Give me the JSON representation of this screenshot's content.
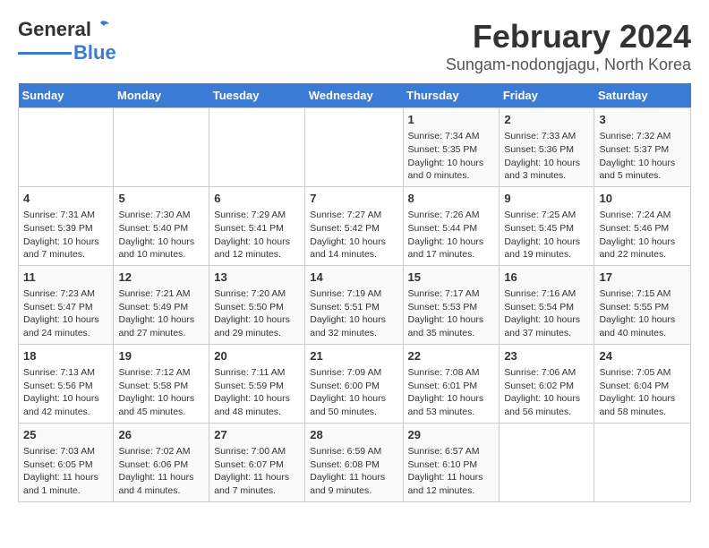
{
  "header": {
    "logo_general": "General",
    "logo_blue": "Blue",
    "title": "February 2024",
    "subtitle": "Sungam-nodongjagu, North Korea"
  },
  "calendar": {
    "weekdays": [
      "Sunday",
      "Monday",
      "Tuesday",
      "Wednesday",
      "Thursday",
      "Friday",
      "Saturday"
    ],
    "weeks": [
      [
        {
          "day": "",
          "info": ""
        },
        {
          "day": "",
          "info": ""
        },
        {
          "day": "",
          "info": ""
        },
        {
          "day": "",
          "info": ""
        },
        {
          "day": "1",
          "info": "Sunrise: 7:34 AM\nSunset: 5:35 PM\nDaylight: 10 hours and 0 minutes."
        },
        {
          "day": "2",
          "info": "Sunrise: 7:33 AM\nSunset: 5:36 PM\nDaylight: 10 hours and 3 minutes."
        },
        {
          "day": "3",
          "info": "Sunrise: 7:32 AM\nSunset: 5:37 PM\nDaylight: 10 hours and 5 minutes."
        }
      ],
      [
        {
          "day": "4",
          "info": "Sunrise: 7:31 AM\nSunset: 5:39 PM\nDaylight: 10 hours and 7 minutes."
        },
        {
          "day": "5",
          "info": "Sunrise: 7:30 AM\nSunset: 5:40 PM\nDaylight: 10 hours and 10 minutes."
        },
        {
          "day": "6",
          "info": "Sunrise: 7:29 AM\nSunset: 5:41 PM\nDaylight: 10 hours and 12 minutes."
        },
        {
          "day": "7",
          "info": "Sunrise: 7:27 AM\nSunset: 5:42 PM\nDaylight: 10 hours and 14 minutes."
        },
        {
          "day": "8",
          "info": "Sunrise: 7:26 AM\nSunset: 5:44 PM\nDaylight: 10 hours and 17 minutes."
        },
        {
          "day": "9",
          "info": "Sunrise: 7:25 AM\nSunset: 5:45 PM\nDaylight: 10 hours and 19 minutes."
        },
        {
          "day": "10",
          "info": "Sunrise: 7:24 AM\nSunset: 5:46 PM\nDaylight: 10 hours and 22 minutes."
        }
      ],
      [
        {
          "day": "11",
          "info": "Sunrise: 7:23 AM\nSunset: 5:47 PM\nDaylight: 10 hours and 24 minutes."
        },
        {
          "day": "12",
          "info": "Sunrise: 7:21 AM\nSunset: 5:49 PM\nDaylight: 10 hours and 27 minutes."
        },
        {
          "day": "13",
          "info": "Sunrise: 7:20 AM\nSunset: 5:50 PM\nDaylight: 10 hours and 29 minutes."
        },
        {
          "day": "14",
          "info": "Sunrise: 7:19 AM\nSunset: 5:51 PM\nDaylight: 10 hours and 32 minutes."
        },
        {
          "day": "15",
          "info": "Sunrise: 7:17 AM\nSunset: 5:53 PM\nDaylight: 10 hours and 35 minutes."
        },
        {
          "day": "16",
          "info": "Sunrise: 7:16 AM\nSunset: 5:54 PM\nDaylight: 10 hours and 37 minutes."
        },
        {
          "day": "17",
          "info": "Sunrise: 7:15 AM\nSunset: 5:55 PM\nDaylight: 10 hours and 40 minutes."
        }
      ],
      [
        {
          "day": "18",
          "info": "Sunrise: 7:13 AM\nSunset: 5:56 PM\nDaylight: 10 hours and 42 minutes."
        },
        {
          "day": "19",
          "info": "Sunrise: 7:12 AM\nSunset: 5:58 PM\nDaylight: 10 hours and 45 minutes."
        },
        {
          "day": "20",
          "info": "Sunrise: 7:11 AM\nSunset: 5:59 PM\nDaylight: 10 hours and 48 minutes."
        },
        {
          "day": "21",
          "info": "Sunrise: 7:09 AM\nSunset: 6:00 PM\nDaylight: 10 hours and 50 minutes."
        },
        {
          "day": "22",
          "info": "Sunrise: 7:08 AM\nSunset: 6:01 PM\nDaylight: 10 hours and 53 minutes."
        },
        {
          "day": "23",
          "info": "Sunrise: 7:06 AM\nSunset: 6:02 PM\nDaylight: 10 hours and 56 minutes."
        },
        {
          "day": "24",
          "info": "Sunrise: 7:05 AM\nSunset: 6:04 PM\nDaylight: 10 hours and 58 minutes."
        }
      ],
      [
        {
          "day": "25",
          "info": "Sunrise: 7:03 AM\nSunset: 6:05 PM\nDaylight: 11 hours and 1 minute."
        },
        {
          "day": "26",
          "info": "Sunrise: 7:02 AM\nSunset: 6:06 PM\nDaylight: 11 hours and 4 minutes."
        },
        {
          "day": "27",
          "info": "Sunrise: 7:00 AM\nSunset: 6:07 PM\nDaylight: 11 hours and 7 minutes."
        },
        {
          "day": "28",
          "info": "Sunrise: 6:59 AM\nSunset: 6:08 PM\nDaylight: 11 hours and 9 minutes."
        },
        {
          "day": "29",
          "info": "Sunrise: 6:57 AM\nSunset: 6:10 PM\nDaylight: 11 hours and 12 minutes."
        },
        {
          "day": "",
          "info": ""
        },
        {
          "day": "",
          "info": ""
        }
      ]
    ]
  }
}
